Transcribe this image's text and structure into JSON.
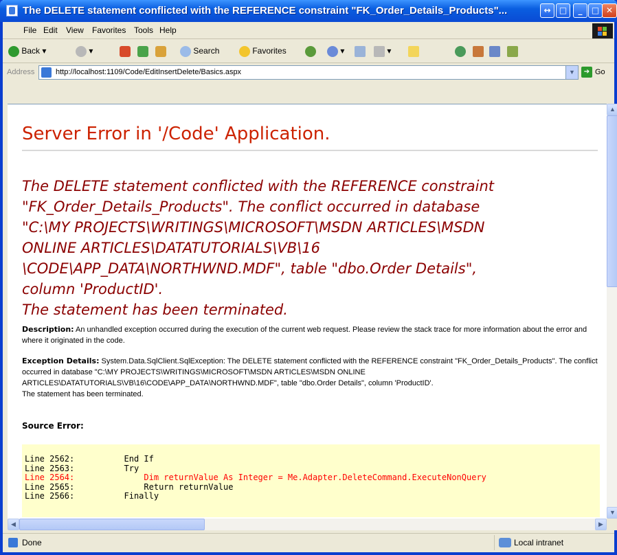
{
  "window": {
    "title": "The DELETE statement conflicted with the REFERENCE constraint \"FK_Order_Details_Products\"..."
  },
  "menu": [
    "File",
    "Edit",
    "View",
    "Favorites",
    "Tools",
    "Help"
  ],
  "toolbar": {
    "back_label": "Back",
    "search_label": "Search",
    "favorites_label": "Favorites"
  },
  "address": {
    "label": "Address",
    "url": "http://localhost:1109/Code/EditInsertDelete/Basics.aspx",
    "go_label": "Go"
  },
  "page": {
    "heading": "Server Error in '/Code' Application.",
    "error_message": [
      "The DELETE statement conflicted with the REFERENCE constraint",
      "\"FK_Order_Details_Products\". The conflict occurred in database",
      "\"C:\\MY PROJECTS\\WRITINGS\\MICROSOFT\\MSDN ARTICLES\\MSDN",
      "ONLINE ARTICLES\\DATATUTORIALS\\VB\\16",
      "\\CODE\\APP_DATA\\NORTHWND.MDF\", table \"dbo.Order Details\",",
      "column 'ProductID'.",
      "The statement has been terminated."
    ],
    "description_label": "Description:",
    "description_text": " An unhandled exception occurred during the execution of the current web request. Please review the stack trace for more information about the error and where it originated in the code.",
    "exception_label": "Exception Details:",
    "exception_text": " System.Data.SqlClient.SqlException: The DELETE statement conflicted with the REFERENCE constraint \"FK_Order_Details_Products\". The conflict occurred in database \"C:\\MY PROJECTS\\WRITINGS\\MICROSOFT\\MSDN ARTICLES\\MSDN ONLINE ARTICLES\\DATATUTORIALS\\VB\\16\\CODE\\APP_DATA\\NORTHWND.MDF\", table \"dbo.Order Details\", column 'ProductID'.",
    "exception_text_2": "The statement has been terminated.",
    "source_error_label": "Source Error:",
    "code_lines": [
      {
        "text": "Line 2562:          End If",
        "error": false
      },
      {
        "text": "Line 2563:          Try",
        "error": false
      },
      {
        "text": "Line 2564:              Dim returnValue As Integer = Me.Adapter.DeleteCommand.ExecuteNonQuery",
        "error": true
      },
      {
        "text": "Line 2565:              Return returnValue",
        "error": false
      },
      {
        "text": "Line 2566:          Finally",
        "error": false
      }
    ]
  },
  "status": {
    "text": "Done",
    "zone": "Local intranet"
  },
  "colors": {
    "titlebar": "#0a5ee0",
    "heading": "#cc2200",
    "error_message": "#8b0000",
    "code_background": "#ffffcc",
    "code_error_line": "#ff0000"
  }
}
